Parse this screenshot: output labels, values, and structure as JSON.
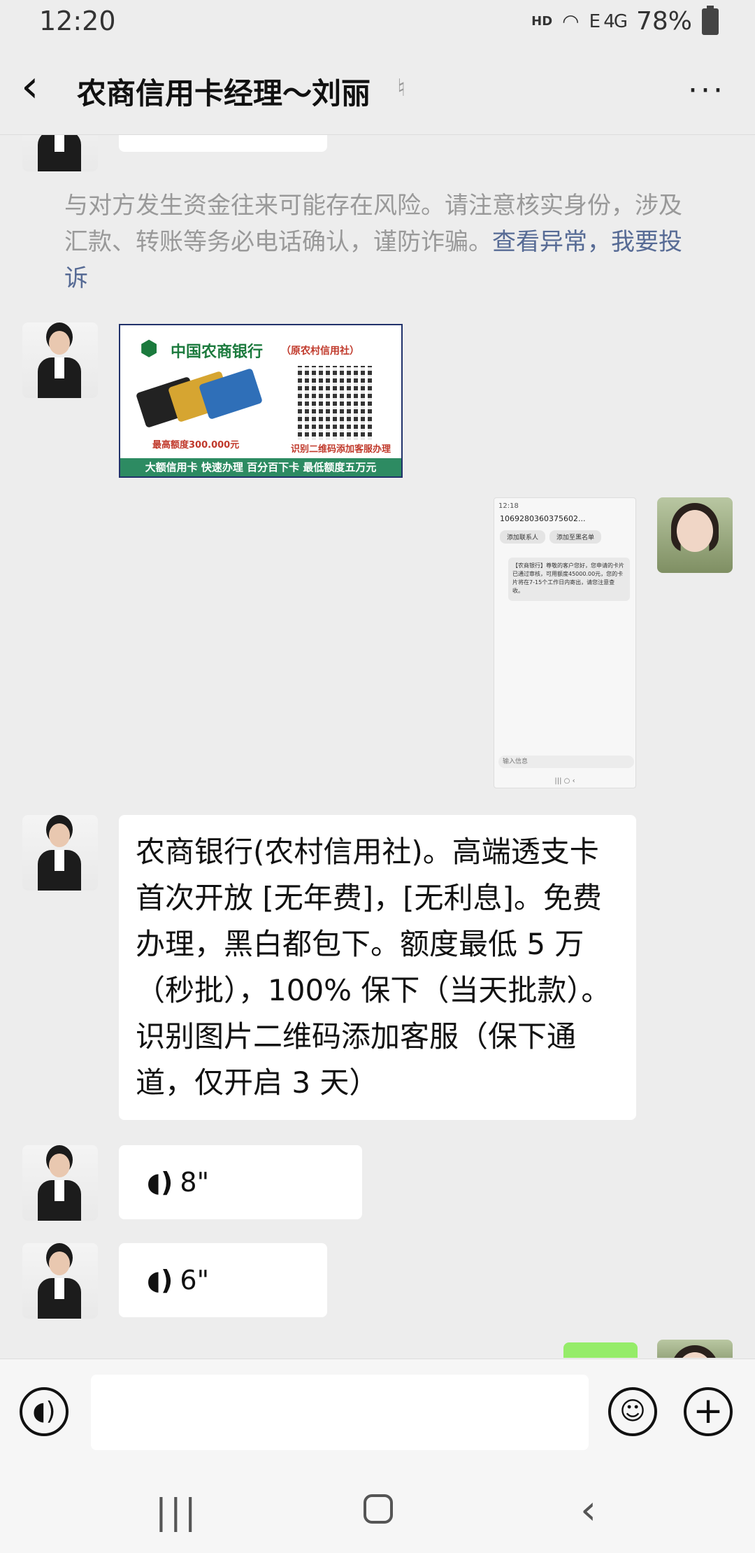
{
  "status_bar": {
    "time": "12:20",
    "network": "HD",
    "signal": "E 4G",
    "battery": "78%"
  },
  "header": {
    "title": "农商信用卡经理～刘丽",
    "more": "···"
  },
  "chat": {
    "warning": {
      "text": "与对方发生资金往来可能存在风险。请注意核实身份，涉及汇款、转账等务必电话确认，谨防诈骗。",
      "link": "查看异常，我要投诉"
    },
    "bank_image": {
      "bank_name": "中国农商银行",
      "bank_sub": "（原农村信用社）",
      "limit": "最高额度300.000元",
      "scan": "识别二维码添加客服办理",
      "bar": "大额信用卡 快速办理 百分百下卡 最低额度五万元"
    },
    "sms_image": {
      "status": "12:18",
      "number": "10692803603756​02...",
      "chip1": "添加联系人",
      "chip2": "添加至黑名单",
      "message": "【农商银行】尊敬的客户您好，您申请的卡片已通过审核，可用额度45000.00元，您的卡片将在7-15个工作日内寄出，请您注意查收。",
      "input": "输入信息"
    },
    "text_message": "农商银行(农村信用社)。高端透支卡首次开放 [无年费]，[无利息]。免费办理，黑白都包下。额度最低 5 万（秒批），100% 保下（当天批款）。识别图片二维码添加客服（保下通道，仅开启 3 天）",
    "voice1": "8\"",
    "voice2": "6\""
  },
  "input_bar": {
    "placeholder": ""
  },
  "colors": {
    "background": "#ededed",
    "bubble": "#ffffff",
    "link": "#576b95",
    "self_bubble": "#95ec69"
  }
}
